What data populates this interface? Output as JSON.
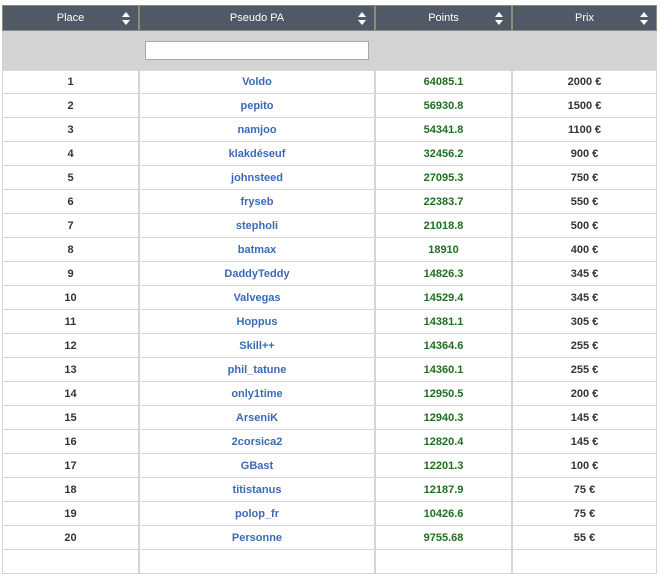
{
  "columns": [
    {
      "label": "Place"
    },
    {
      "label": "Pseudo PA"
    },
    {
      "label": "Points"
    },
    {
      "label": "Prix"
    }
  ],
  "filter": {
    "value": "",
    "placeholder": ""
  },
  "rows": [
    {
      "place": "1",
      "pseudo": "Voldo",
      "points": "64085.1",
      "prix": "2000 €"
    },
    {
      "place": "2",
      "pseudo": "pepito",
      "points": "56930.8",
      "prix": "1500 €"
    },
    {
      "place": "3",
      "pseudo": "namjoo",
      "points": "54341.8",
      "prix": "1100 €"
    },
    {
      "place": "4",
      "pseudo": "klakdéseuf",
      "points": "32456.2",
      "prix": "900 €"
    },
    {
      "place": "5",
      "pseudo": "johnsteed",
      "points": "27095.3",
      "prix": "750 €"
    },
    {
      "place": "6",
      "pseudo": "fryseb",
      "points": "22383.7",
      "prix": "550 €"
    },
    {
      "place": "7",
      "pseudo": "stepholi",
      "points": "21018.8",
      "prix": "500 €"
    },
    {
      "place": "8",
      "pseudo": "batmax",
      "points": "18910",
      "prix": "400 €"
    },
    {
      "place": "9",
      "pseudo": "DaddyTeddy",
      "points": "14826.3",
      "prix": "345 €"
    },
    {
      "place": "10",
      "pseudo": "Valvegas",
      "points": "14529.4",
      "prix": "345 €"
    },
    {
      "place": "11",
      "pseudo": "Hoppus",
      "points": "14381.1",
      "prix": "305 €"
    },
    {
      "place": "12",
      "pseudo": "Skill++",
      "points": "14364.6",
      "prix": "255 €"
    },
    {
      "place": "13",
      "pseudo": "phil_tatune",
      "points": "14360.1",
      "prix": "255 €"
    },
    {
      "place": "14",
      "pseudo": "only1time",
      "points": "12950.5",
      "prix": "200 €"
    },
    {
      "place": "15",
      "pseudo": "ArseniK",
      "points": "12940.3",
      "prix": "145 €"
    },
    {
      "place": "16",
      "pseudo": "2corsica2",
      "points": "12820.4",
      "prix": "145 €"
    },
    {
      "place": "17",
      "pseudo": "GBast",
      "points": "12201.3",
      "prix": "100 €"
    },
    {
      "place": "18",
      "pseudo": "titistanus",
      "points": "12187.9",
      "prix": "75 €"
    },
    {
      "place": "19",
      "pseudo": "polop_fr",
      "points": "10426.6",
      "prix": "75 €"
    },
    {
      "place": "20",
      "pseudo": "Personne",
      "points": "9755.68",
      "prix": "55 €"
    },
    {
      "place": "",
      "pseudo": "",
      "points": "",
      "prix": ""
    }
  ],
  "icons": {
    "sort": "sort-arrows-icon"
  },
  "colors": {
    "header_bg": "#4f5a66",
    "filter_bg": "#d3d3d3",
    "pseudo_link": "#3b6ab5",
    "points_text": "#1f6f1f"
  }
}
